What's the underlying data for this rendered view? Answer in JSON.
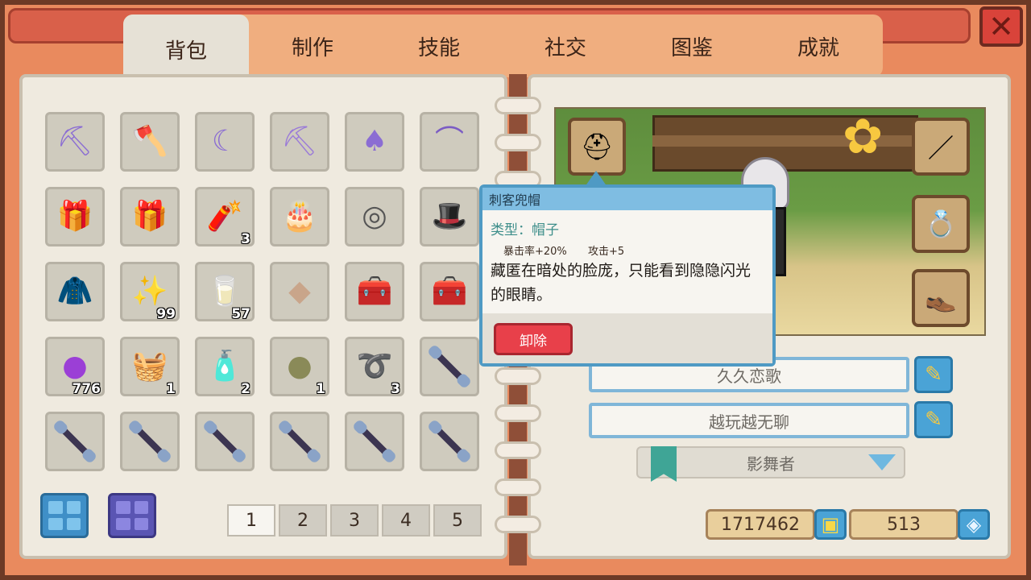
{
  "tabs": [
    {
      "label": "背包",
      "active": true
    },
    {
      "label": "制作"
    },
    {
      "label": "技能"
    },
    {
      "label": "社交"
    },
    {
      "label": "图鉴"
    },
    {
      "label": "成就"
    }
  ],
  "close_label": "✕",
  "inventory": [
    {
      "icon": "pickaxe-icon",
      "glyph": "⛏",
      "color": "#8b6dd3",
      "qty": ""
    },
    {
      "icon": "axe-icon",
      "glyph": "🪓",
      "color": "#8b6dd3",
      "qty": ""
    },
    {
      "icon": "sickle-icon",
      "glyph": "☾",
      "color": "#8b6dd3",
      "qty": ""
    },
    {
      "icon": "hoe-icon",
      "glyph": "⛏",
      "color": "#9a7ad8",
      "qty": ""
    },
    {
      "icon": "shovel-icon",
      "glyph": "♠",
      "color": "#8b6dd3",
      "qty": ""
    },
    {
      "icon": "fishing-rod-icon",
      "glyph": "⌒",
      "color": "#7b5cc4",
      "qty": ""
    },
    {
      "icon": "blue-gift-box-icon",
      "glyph": "🎁",
      "color": "#3a8fd6",
      "qty": ""
    },
    {
      "icon": "blue-gift-box-icon",
      "glyph": "🎁",
      "color": "#3a8fd6",
      "qty": ""
    },
    {
      "icon": "firecracker-icon",
      "glyph": "🧨",
      "color": "#c9422e",
      "qty": "3"
    },
    {
      "icon": "heart-cake-icon",
      "glyph": "🎂",
      "color": "#e85a7a",
      "qty": ""
    },
    {
      "icon": "ring-stone-icon",
      "glyph": "◎",
      "color": "#555",
      "qty": ""
    },
    {
      "icon": "top-hat-icon",
      "glyph": "🎩",
      "color": "#222",
      "qty": ""
    },
    {
      "icon": "dark-coat-icon",
      "glyph": "🧥",
      "color": "#1f3357",
      "qty": ""
    },
    {
      "icon": "sparkle-seeds-icon",
      "glyph": "✨",
      "color": "#9ab",
      "qty": "99"
    },
    {
      "icon": "milk-jug-icon",
      "glyph": "🥛",
      "color": "#cde",
      "qty": "57"
    },
    {
      "icon": "crystal-shards-icon",
      "glyph": "◆",
      "color": "#c9a58a",
      "qty": ""
    },
    {
      "icon": "treasure-chest-icon",
      "glyph": "🧰",
      "color": "#d8443a",
      "qty": ""
    },
    {
      "icon": "treasure-chest-icon",
      "glyph": "🧰",
      "color": "#d8443a",
      "qty": ""
    },
    {
      "icon": "purple-orb-icon",
      "glyph": "●",
      "color": "#9b3fd6",
      "qty": "776"
    },
    {
      "icon": "basket-icon",
      "glyph": "🧺",
      "color": "#c8543a",
      "qty": "1"
    },
    {
      "icon": "potion-bottle-icon",
      "glyph": "🧴",
      "color": "#e8a83a",
      "qty": "2"
    },
    {
      "icon": "stone-icon",
      "glyph": "●",
      "color": "#8a8a58",
      "qty": "1"
    },
    {
      "icon": "rope-icon",
      "glyph": "➰",
      "color": "#c8a030",
      "qty": "3"
    },
    {
      "icon": "wand-icon",
      "glyph": "",
      "color": "",
      "qty": ""
    },
    {
      "icon": "wand-icon",
      "glyph": "",
      "color": "",
      "qty": ""
    },
    {
      "icon": "wand-icon",
      "glyph": "",
      "color": "",
      "qty": ""
    },
    {
      "icon": "wand-icon",
      "glyph": "",
      "color": "",
      "qty": ""
    },
    {
      "icon": "wand-icon",
      "glyph": "",
      "color": "",
      "qty": ""
    },
    {
      "icon": "wand-icon",
      "glyph": "",
      "color": "",
      "qty": ""
    },
    {
      "icon": "wand-icon",
      "glyph": "",
      "color": "",
      "qty": ""
    }
  ],
  "pages": [
    "1",
    "2",
    "3",
    "4",
    "5"
  ],
  "current_page": "1",
  "equipment": {
    "hat": {
      "glyph": "⛑"
    },
    "weapon": {
      "glyph": "／"
    },
    "ring": {
      "glyph": "💍"
    },
    "shoes": {
      "glyph": "👞"
    }
  },
  "profile": {
    "name": "久久恋歌",
    "farm": "越玩越无聊",
    "title": "影舞者",
    "pencil_glyph": "✎"
  },
  "currency": {
    "gold": "1717462",
    "gold_glyph": "▣",
    "gems": "513",
    "gem_glyph": "◈"
  },
  "tooltip": {
    "name": "刺客兜帽",
    "type": "类型：帽子",
    "stats": [
      "暴击率+20%",
      "攻击+5"
    ],
    "description": "藏匿在暗处的脸庞，只能看到隐隐闪光的眼睛。",
    "unequip_label": "卸除"
  },
  "colors": {
    "accent_blue": "#4f9ac4",
    "unequip_red": "#e8404a",
    "tab_bar": "#f0ae7f"
  }
}
